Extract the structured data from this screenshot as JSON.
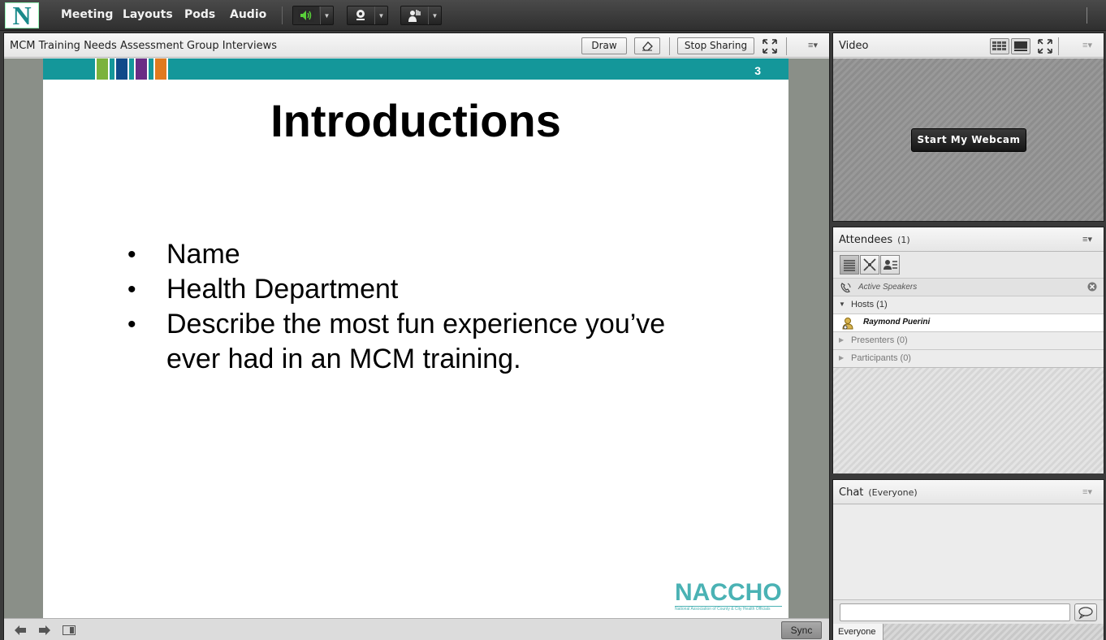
{
  "app": {
    "logo_letter": "N",
    "menu": [
      "Meeting",
      "Layouts",
      "Pods",
      "Audio"
    ],
    "colors": {
      "brand": "#1a8a8a",
      "speaker_active": "#59d13a"
    },
    "toolbar_icons": [
      "speaker-icon",
      "webcam-icon",
      "raise-hand-icon"
    ]
  },
  "share_pod": {
    "title": "MCM Training Needs Assessment Group Interviews",
    "draw_label": "Draw",
    "stop_sharing_label": "Stop Sharing",
    "sync_label": "Sync",
    "slide": {
      "number": "3",
      "title": "Introductions",
      "bullet_symbol": "•",
      "bullets": [
        "Name",
        "Health Department",
        "Describe the most fun experience you’ve",
        "ever had in an MCM training."
      ],
      "logo_text": "NACCHO",
      "logo_subtext": "National Association of County & City Health Officials",
      "band_colors": [
        "#7bb23c",
        "#104a8a",
        "#6a2c85",
        "#e07a1f"
      ],
      "band_color": "#14979a"
    }
  },
  "video_pod": {
    "title": "Video",
    "start_webcam_label": "Start My Webcam"
  },
  "attendees_pod": {
    "title": "Attendees",
    "count": "(1)",
    "active_speakers_label": "Active Speakers",
    "hosts_label": "Hosts (1)",
    "host_name": "Raymond  Puerini",
    "presenters_label": "Presenters (0)",
    "participants_label": "Participants (0)"
  },
  "chat_pod": {
    "title": "Chat",
    "audience": "(Everyone)",
    "input_value": "",
    "tab_everyone": "Everyone"
  }
}
